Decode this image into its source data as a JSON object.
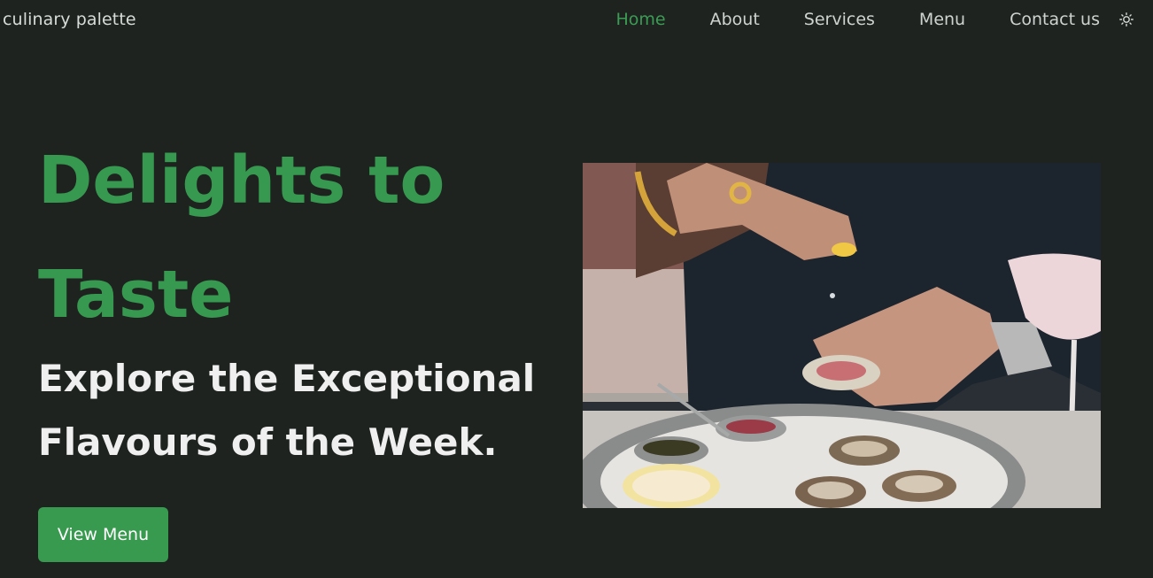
{
  "header": {
    "brand": "culinary palette",
    "nav": {
      "home": "Home",
      "about": "About",
      "services": "Services",
      "menu": "Menu",
      "contact": "Contact us"
    },
    "theme_icon": "sun-icon"
  },
  "hero": {
    "title_line1": "Delights to",
    "title_line2": "Taste",
    "subtitle_line1": "Explore the Exceptional",
    "subtitle_line2": "Flavours of the Week.",
    "cta_label": "View Menu",
    "image_subject": "oyster-platter-photo"
  },
  "colors": {
    "background": "#1e2320",
    "accent": "#37984f",
    "button": "#379a4e",
    "nav_text": "#cfd3cf"
  }
}
